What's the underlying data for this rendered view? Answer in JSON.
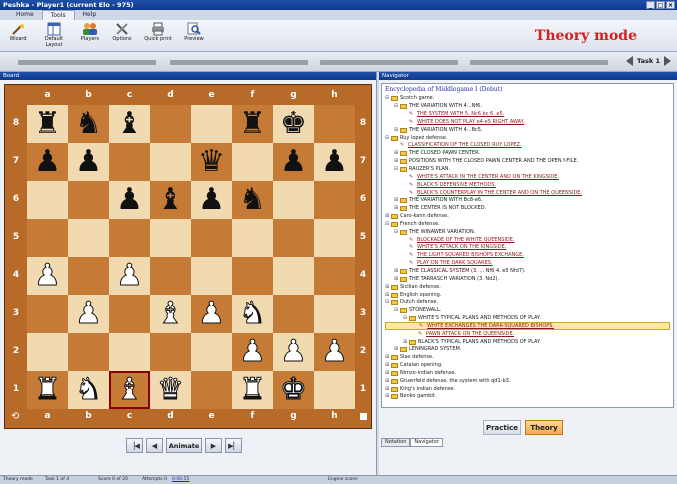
{
  "window": {
    "title": "Peshka - Player1 (current Elo - 975)"
  },
  "ribbon_tabs": [
    "Home",
    "Tools",
    "Help"
  ],
  "ribbon": [
    {
      "name": "wizard",
      "label": "Wizard",
      "icon": "wand-icon"
    },
    {
      "name": "default-layout",
      "label": "Default Layout",
      "icon": "layout-icon"
    },
    {
      "name": "players",
      "label": "Players",
      "icon": "players-icon"
    },
    {
      "name": "options",
      "label": "Options",
      "icon": "tools-icon"
    },
    {
      "name": "quick-print",
      "label": "Quick print",
      "icon": "printer-icon"
    },
    {
      "name": "preview",
      "label": "Preview",
      "icon": "magnifier-icon"
    }
  ],
  "mode_title": "Theory mode",
  "task_label": "Task 1",
  "board_panel": {
    "caption": "Board"
  },
  "files": [
    "a",
    "b",
    "c",
    "d",
    "e",
    "f",
    "g",
    "h"
  ],
  "ranks": [
    "8",
    "7",
    "6",
    "5",
    "4",
    "3",
    "2",
    "1"
  ],
  "board": [
    [
      "r",
      "n",
      "b",
      "",
      "",
      "r",
      "k",
      ""
    ],
    [
      "p",
      "p",
      "",
      "",
      "q",
      "",
      "p",
      "p"
    ],
    [
      "",
      "",
      "p",
      "b",
      "p",
      "n",
      "",
      ""
    ],
    [
      "",
      "",
      "",
      "",
      "",
      "",
      "",
      ""
    ],
    [
      "P",
      "",
      "P",
      "",
      "",
      "",
      "",
      ""
    ],
    [
      "",
      "P",
      "",
      "B",
      "P",
      "N",
      "",
      ""
    ],
    [
      "",
      "",
      "",
      "",
      "",
      "P",
      "P",
      "P"
    ],
    [
      "R",
      "N",
      "B",
      "Q",
      "",
      "R",
      "K",
      ""
    ]
  ],
  "highlight_square": "c1",
  "animate_label": "Animate",
  "navigator": {
    "caption": "Navigator",
    "title": "Encyclopedia of Middlegame I (Debut)",
    "items": [
      {
        "level": 0,
        "type": "folder",
        "pm": "⊟",
        "text": "Scotch game."
      },
      {
        "level": 1,
        "type": "folder",
        "pm": "⊟",
        "text": "THE VARIATION WITH 4...Nf6."
      },
      {
        "level": 2,
        "type": "link",
        "pm": "",
        "text": "THE SYSTEM WITH 5. Nc6 bc 6. e5."
      },
      {
        "level": 2,
        "type": "link",
        "pm": "",
        "text": "WHITE DOES NOT PLAY e4-e5 RIGHT AWAY."
      },
      {
        "level": 1,
        "type": "folder",
        "pm": "⊞",
        "text": "THE VARIATION WITH 4...Bc5."
      },
      {
        "level": 0,
        "type": "folder",
        "pm": "⊟",
        "text": "Ruy lopez defense."
      },
      {
        "level": 1,
        "type": "link",
        "pm": "",
        "text": "CLASSIFICATION OF THE CLOSED RUY LOPEZ."
      },
      {
        "level": 1,
        "type": "folder",
        "pm": "⊞",
        "text": "THE CLOSED PAWN CENTER."
      },
      {
        "level": 1,
        "type": "folder",
        "pm": "⊞",
        "text": "POSITIONS WITH THE CLOSED PAWN CENTER AND THE OPEN f-FILE."
      },
      {
        "level": 1,
        "type": "folder",
        "pm": "⊟",
        "text": "RAUZER'S PLAN."
      },
      {
        "level": 2,
        "type": "link",
        "pm": "",
        "text": "WHITE'S ATTACK IN THE CENTER AND ON THE KINGSIDE."
      },
      {
        "level": 2,
        "type": "link",
        "pm": "",
        "text": "BLACK'S DEFENSIVE METHODS."
      },
      {
        "level": 2,
        "type": "link",
        "pm": "",
        "text": "BLACK'S COUNTERPLAY IN THE CENTER AND ON THE QUEENSIDE."
      },
      {
        "level": 1,
        "type": "folder",
        "pm": "⊞",
        "text": "THE VARIATION WITH Bc8-e6."
      },
      {
        "level": 1,
        "type": "folder",
        "pm": "⊞",
        "text": "THE CENTER IS NOT BLOCKED."
      },
      {
        "level": 0,
        "type": "folder",
        "pm": "⊞",
        "text": "Caro-kann defense."
      },
      {
        "level": 0,
        "type": "folder",
        "pm": "⊟",
        "text": "French defense."
      },
      {
        "level": 1,
        "type": "folder",
        "pm": "⊟",
        "text": "THE WINAWER VARIATION."
      },
      {
        "level": 2,
        "type": "link",
        "pm": "",
        "text": "BLOCKADE OF THE WHITE QUEENSIDE."
      },
      {
        "level": 2,
        "type": "link",
        "pm": "",
        "text": "WHITE'S ATTACK ON THE KINGSIDE."
      },
      {
        "level": 2,
        "type": "link",
        "pm": "",
        "text": "THE LIGHT-SQUARED BISHOPS EXCHANGE."
      },
      {
        "level": 2,
        "type": "link",
        "pm": "",
        "text": "PLAY ON THE DARK SQUARES."
      },
      {
        "level": 1,
        "type": "folder",
        "pm": "⊞",
        "text": "THE CLASSICAL SYSTEM (3. ... Nf6 4. e5 Nfd7)."
      },
      {
        "level": 1,
        "type": "folder",
        "pm": "⊞",
        "text": "THE TARRASCH VARIATION (3. Nd2)."
      },
      {
        "level": 0,
        "type": "folder",
        "pm": "⊞",
        "text": "Sicilian defense."
      },
      {
        "level": 0,
        "type": "folder",
        "pm": "⊞",
        "text": "English opening."
      },
      {
        "level": 0,
        "type": "folder",
        "pm": "⊟",
        "text": "Dutch defense."
      },
      {
        "level": 1,
        "type": "folder",
        "pm": "⊟",
        "text": "STONEWALL."
      },
      {
        "level": 2,
        "type": "folder",
        "pm": "⊟",
        "text": "WHITE'S TYPICAL PLANS AND METHODS OF PLAY."
      },
      {
        "level": 3,
        "type": "link",
        "pm": "",
        "text": "WHITE EXCHANGES THE DARK-SQUARED BISHOPS.",
        "selected": true
      },
      {
        "level": 3,
        "type": "link",
        "pm": "",
        "text": "PAWN ATTACK ON THE QUEENSIDE."
      },
      {
        "level": 2,
        "type": "folder",
        "pm": "⊞",
        "text": "BLACK'S TYPICAL PLANS AND METHODS OF PLAY."
      },
      {
        "level": 1,
        "type": "folder",
        "pm": "⊞",
        "text": "LENINGRAD SYSTEM."
      },
      {
        "level": 0,
        "type": "folder",
        "pm": "⊞",
        "text": "Slav defense."
      },
      {
        "level": 0,
        "type": "folder",
        "pm": "⊞",
        "text": "Catalan opening."
      },
      {
        "level": 0,
        "type": "folder",
        "pm": "⊞",
        "text": "Nimzo-indian defense."
      },
      {
        "level": 0,
        "type": "folder",
        "pm": "⊞",
        "text": "Gruenfeld defense, the system with qd1-b3."
      },
      {
        "level": 0,
        "type": "folder",
        "pm": "⊞",
        "text": "King's indian defense."
      },
      {
        "level": 0,
        "type": "folder",
        "pm": "⊞",
        "text": "Benko gambit."
      }
    ],
    "practice_label": "Practice",
    "theory_label": "Theory",
    "tabs": [
      "Notation",
      "Navigator"
    ]
  },
  "status": {
    "mode": "Theory mode",
    "task": "Task 1 of 4",
    "score": "Score 0 of 20",
    "attempts": "Attempts 0",
    "time": "0:00:55",
    "engine": "Engine score:"
  },
  "colors": {
    "accent": "#d42020",
    "board_light": "#f1d9b0",
    "board_dark": "#c57a35",
    "selection": "#ffe89a"
  }
}
